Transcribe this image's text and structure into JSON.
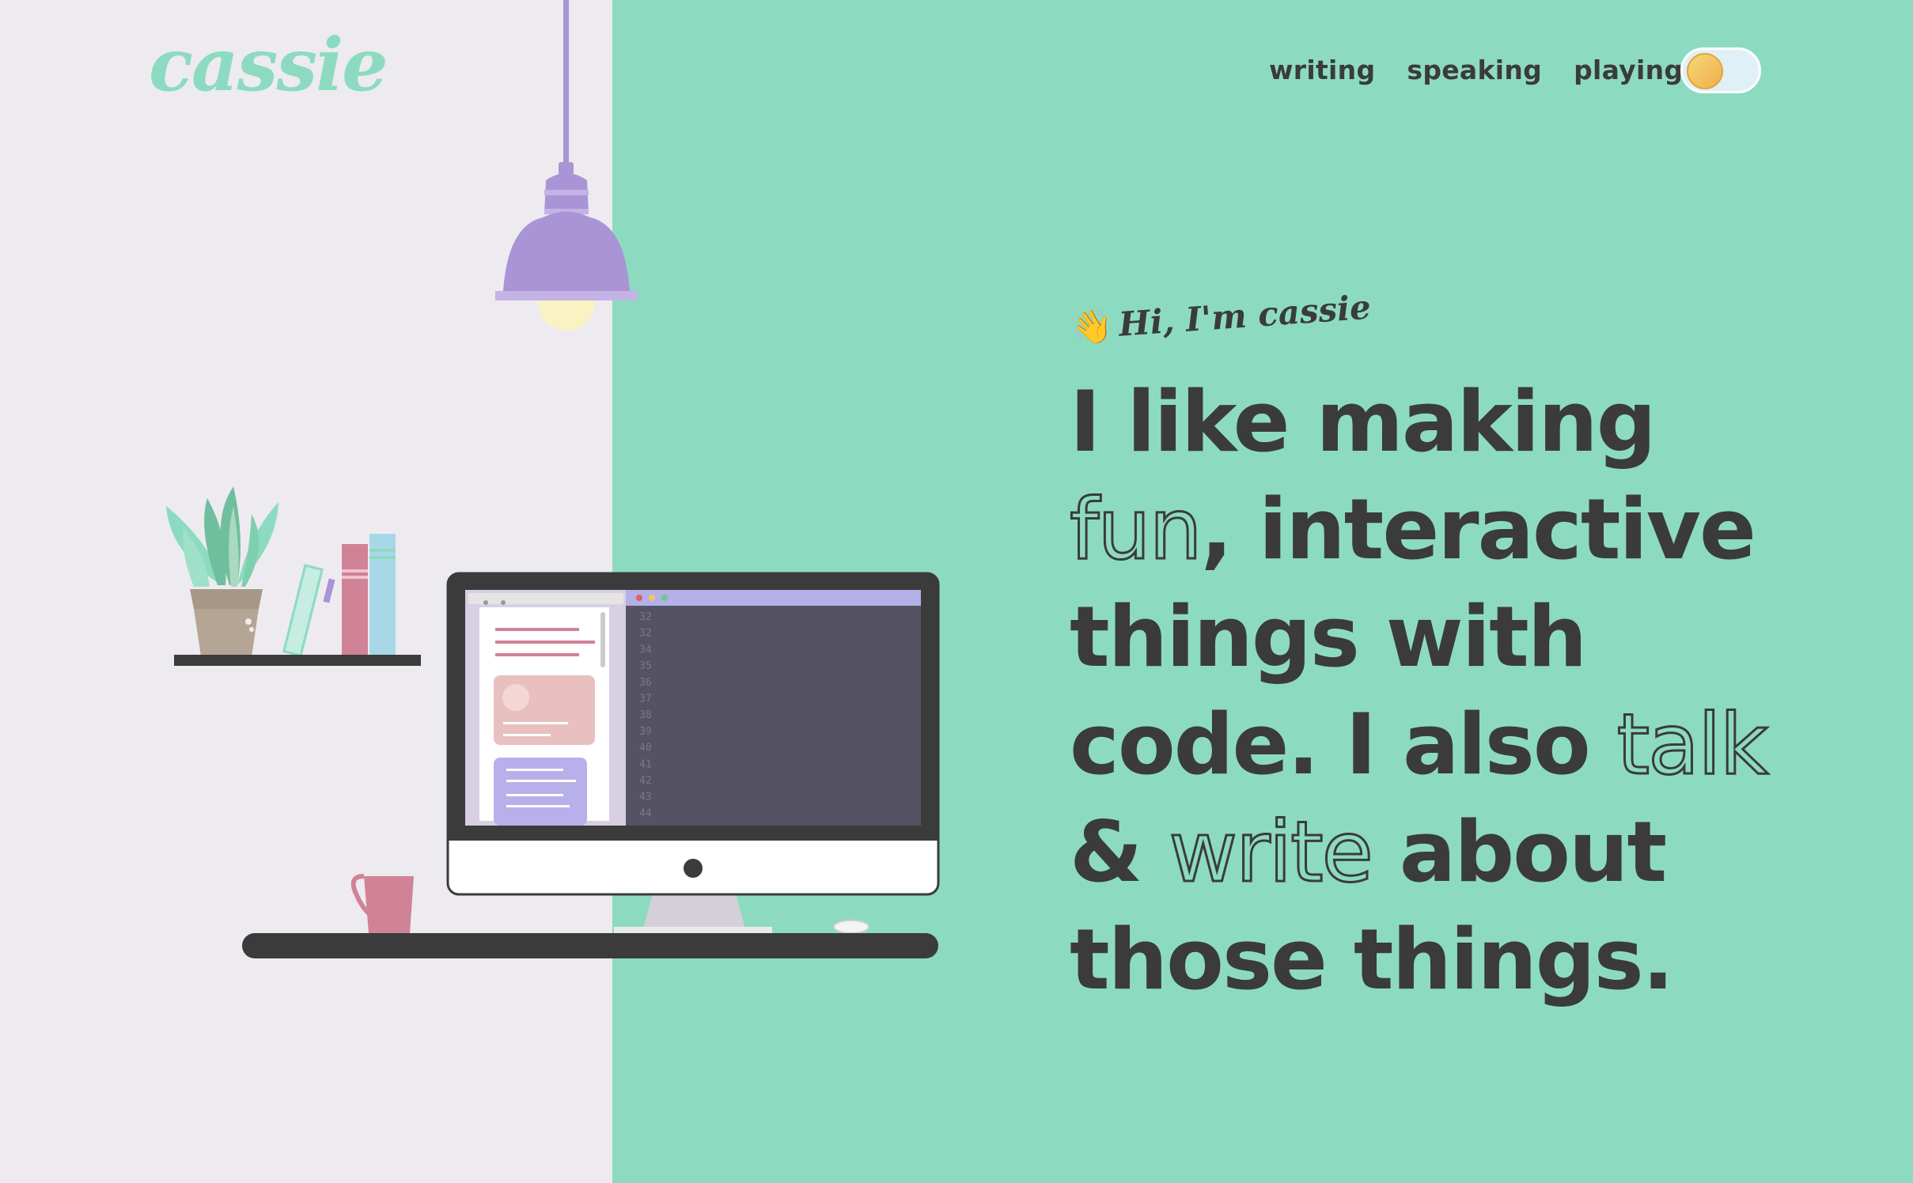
{
  "brand": {
    "logo_text": "cassie"
  },
  "nav": {
    "items": [
      {
        "label": "writing"
      },
      {
        "label": "speaking"
      },
      {
        "label": "playing"
      }
    ],
    "theme_toggle": {
      "icon": "sun-moon-icon",
      "state": "light"
    }
  },
  "hero": {
    "greeting_emoji": "👋",
    "greeting_text": "Hi, I'm cassie",
    "headline": {
      "part1": "I like making ",
      "fun": "fun",
      "part2": ", interactive things with code. I also ",
      "talk": "talk",
      "part3": " & ",
      "write": "write",
      "part4": " about those things."
    }
  },
  "illustration": {
    "code_line_numbers": [
      "32",
      "32",
      "34",
      "35",
      "36",
      "37",
      "38",
      "39",
      "40",
      "41",
      "42",
      "43",
      "44"
    ],
    "icons": [
      "pendant-lamp-icon",
      "potted-plant-icon",
      "books-icon",
      "imac-computer-icon",
      "mug-icon",
      "mouse-icon"
    ]
  },
  "colors": {
    "mint": "#8cdbc0",
    "light_gray": "#edebef",
    "dark_text": "#3b3b3b",
    "lavender": "#a994d6",
    "pink": "#d08297",
    "light_blue": "#a8d8e8"
  }
}
